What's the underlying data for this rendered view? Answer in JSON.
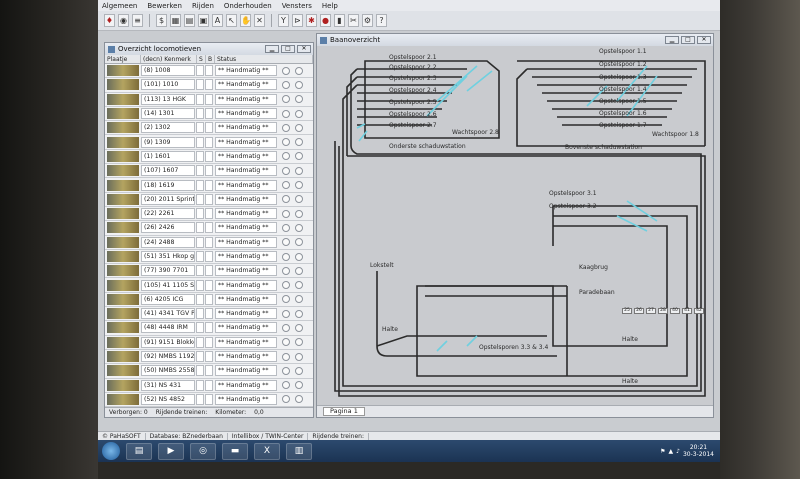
{
  "menu": [
    "Algemeen",
    "Bewerken",
    "Rijden",
    "Onderhouden",
    "Vensters",
    "Help"
  ],
  "locos": {
    "title": "Overzicht locomotieven",
    "headers": [
      "Plaatje",
      "(decn) Kenmerk",
      "S",
      "B",
      "Status"
    ],
    "rows": [
      {
        "name": "(8) 1008",
        "status": "** Handmatig **"
      },
      {
        "name": "(101) 1010",
        "status": "** Handmatig **"
      },
      {
        "name": "(113) 13 HGK",
        "status": "** Handmatig **"
      },
      {
        "name": "(14) 1301",
        "status": "** Handmatig **"
      },
      {
        "name": "(2) 1302",
        "status": "** Handmatig **"
      },
      {
        "name": "(9) 1309",
        "status": "** Handmatig **"
      },
      {
        "name": "(1) 1601",
        "status": "** Handmatig **"
      },
      {
        "name": "(107) 1607",
        "status": "** Handmatig **"
      },
      {
        "name": "(18) 1619",
        "status": "** Handmatig **"
      },
      {
        "name": "(20) 2011 Sprinter",
        "status": "** Handmatig **"
      },
      {
        "name": "(22) 2261",
        "status": "** Handmatig **"
      },
      {
        "name": "(26) 2426",
        "status": "** Handmatig **"
      },
      {
        "name": "(24) 2488",
        "status": "** Handmatig **"
      },
      {
        "name": "(51) 351 Hkop gex",
        "status": "** Handmatig **"
      },
      {
        "name": "(77) 390 7701",
        "status": "** Handmatig **"
      },
      {
        "name": "(105) 41 1105 SSN",
        "status": "** Handmatig **"
      },
      {
        "name": "(6) 4205 ICG",
        "status": "** Handmatig **"
      },
      {
        "name": "(41) 4341 TGV PK",
        "status": "** Handmatig **"
      },
      {
        "name": "(48) 4448 IRM",
        "status": "** Handmatig **"
      },
      {
        "name": "(91) 9151 Blokked",
        "status": "** Handmatig **"
      },
      {
        "name": "(92) NMBS 1192",
        "status": "** Handmatig **"
      },
      {
        "name": "(50) NMBS 2558",
        "status": "** Handmatig **"
      },
      {
        "name": "(31) NS 431",
        "status": "** Handmatig **"
      },
      {
        "name": "(52) NS 4852",
        "status": "** Handmatig **"
      }
    ],
    "footer": {
      "hidden": "Verborgen: 0",
      "riding": "Rijdende treinen:",
      "km": "Kilometer:",
      "km_value": "0,0"
    }
  },
  "track": {
    "title": "Baanoverzicht",
    "tab": "Pagina 1",
    "labels": {
      "o21": "Opstelspoor 2.1",
      "o22": "Opstelspoor 2.2",
      "o23": "Opstelspoor 2.3",
      "o24": "Opstelspoor 2.4",
      "o25": "Opstelspoor 2.5",
      "o26": "Opstelspoor 2.6",
      "o27": "Opstelspoor 2.7",
      "w28": "Wachtspoor 2.8",
      "onder": "Onderste schaduwstation",
      "o11": "Opstelspoor 1.1",
      "o12": "Opstelspoor 1.2",
      "o13": "Opstelspoor 1.3",
      "o14": "Opstelspoor 1.4",
      "o15": "Opstelspoor 1.5",
      "o16": "Opstelspoor 1.6",
      "o17": "Opstelspoor 1.7",
      "w18": "Wachtspoor 1.8",
      "boven": "Bovenste schaduwstation",
      "o31": "Opstelspoor 3.1",
      "o32": "Opstelspoor 3.2",
      "lok": "Lokstelt",
      "kaag": "Kaagbrug",
      "parade": "Paradebaan",
      "halte1": "Halte",
      "halte2": "Halte",
      "halte3": "Halte",
      "o33": "Opstelsporen 3.3 & 3.4"
    },
    "blocks_row": [
      "25",
      "26",
      "27",
      "28",
      "40",
      "41",
      "42"
    ]
  },
  "status": [
    "© PaHaSOFT",
    "Database: BZnederbaan",
    "Intellibox / TWIN-Center",
    "Rijdende treinen:"
  ],
  "clock": {
    "time": "20:21",
    "date": "30-3-2014"
  }
}
